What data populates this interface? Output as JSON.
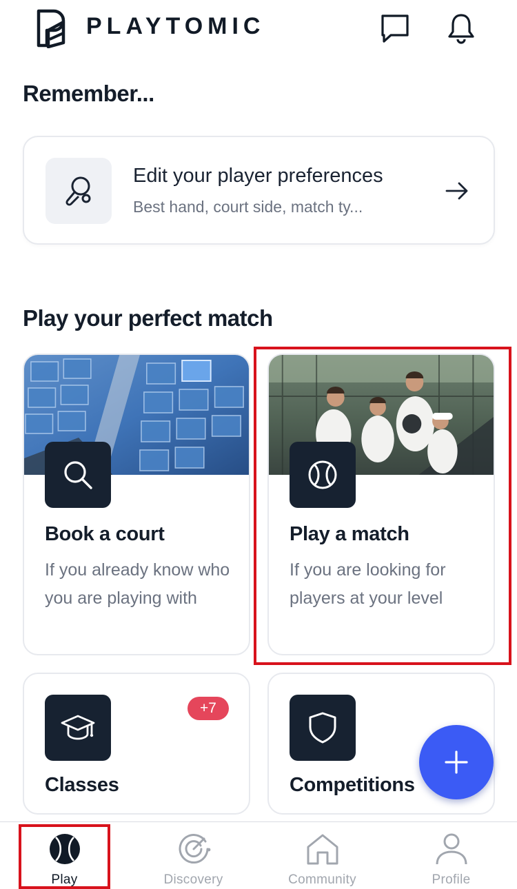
{
  "header": {
    "brand": "PLAYTOMIC",
    "icons": [
      "playtomic-logo-icon",
      "chat-icon",
      "bell-icon"
    ]
  },
  "remember": {
    "title": "Remember...",
    "card": {
      "title": "Edit your player preferences",
      "subtitle": "Best hand, court side, match ty...",
      "icon": "racket-icon"
    }
  },
  "play": {
    "title": "Play your perfect match",
    "cards": [
      {
        "title": "Book a court",
        "description": "If you already know who you are playing with",
        "icon": "search-icon"
      },
      {
        "title": "Play a match",
        "description": "If you are looking for players at your level",
        "icon": "ball-icon"
      },
      {
        "title": "Classes",
        "badge": "+7",
        "icon": "graduation-cap-icon"
      },
      {
        "title": "Competitions",
        "icon": "shield-icon"
      }
    ]
  },
  "fab": {
    "icon": "plus-icon"
  },
  "tabs": [
    {
      "label": "Play",
      "icon": "ball-icon",
      "active": true
    },
    {
      "label": "Discovery",
      "icon": "radar-icon",
      "active": false
    },
    {
      "label": "Community",
      "icon": "home-icon",
      "active": false
    },
    {
      "label": "Profile",
      "icon": "user-icon",
      "active": false
    }
  ],
  "colors": {
    "primary_dark": "#172231",
    "fab": "#3b5bf5",
    "badge": "#e5465b",
    "highlight": "#d8121c",
    "muted": "#6b7280"
  }
}
